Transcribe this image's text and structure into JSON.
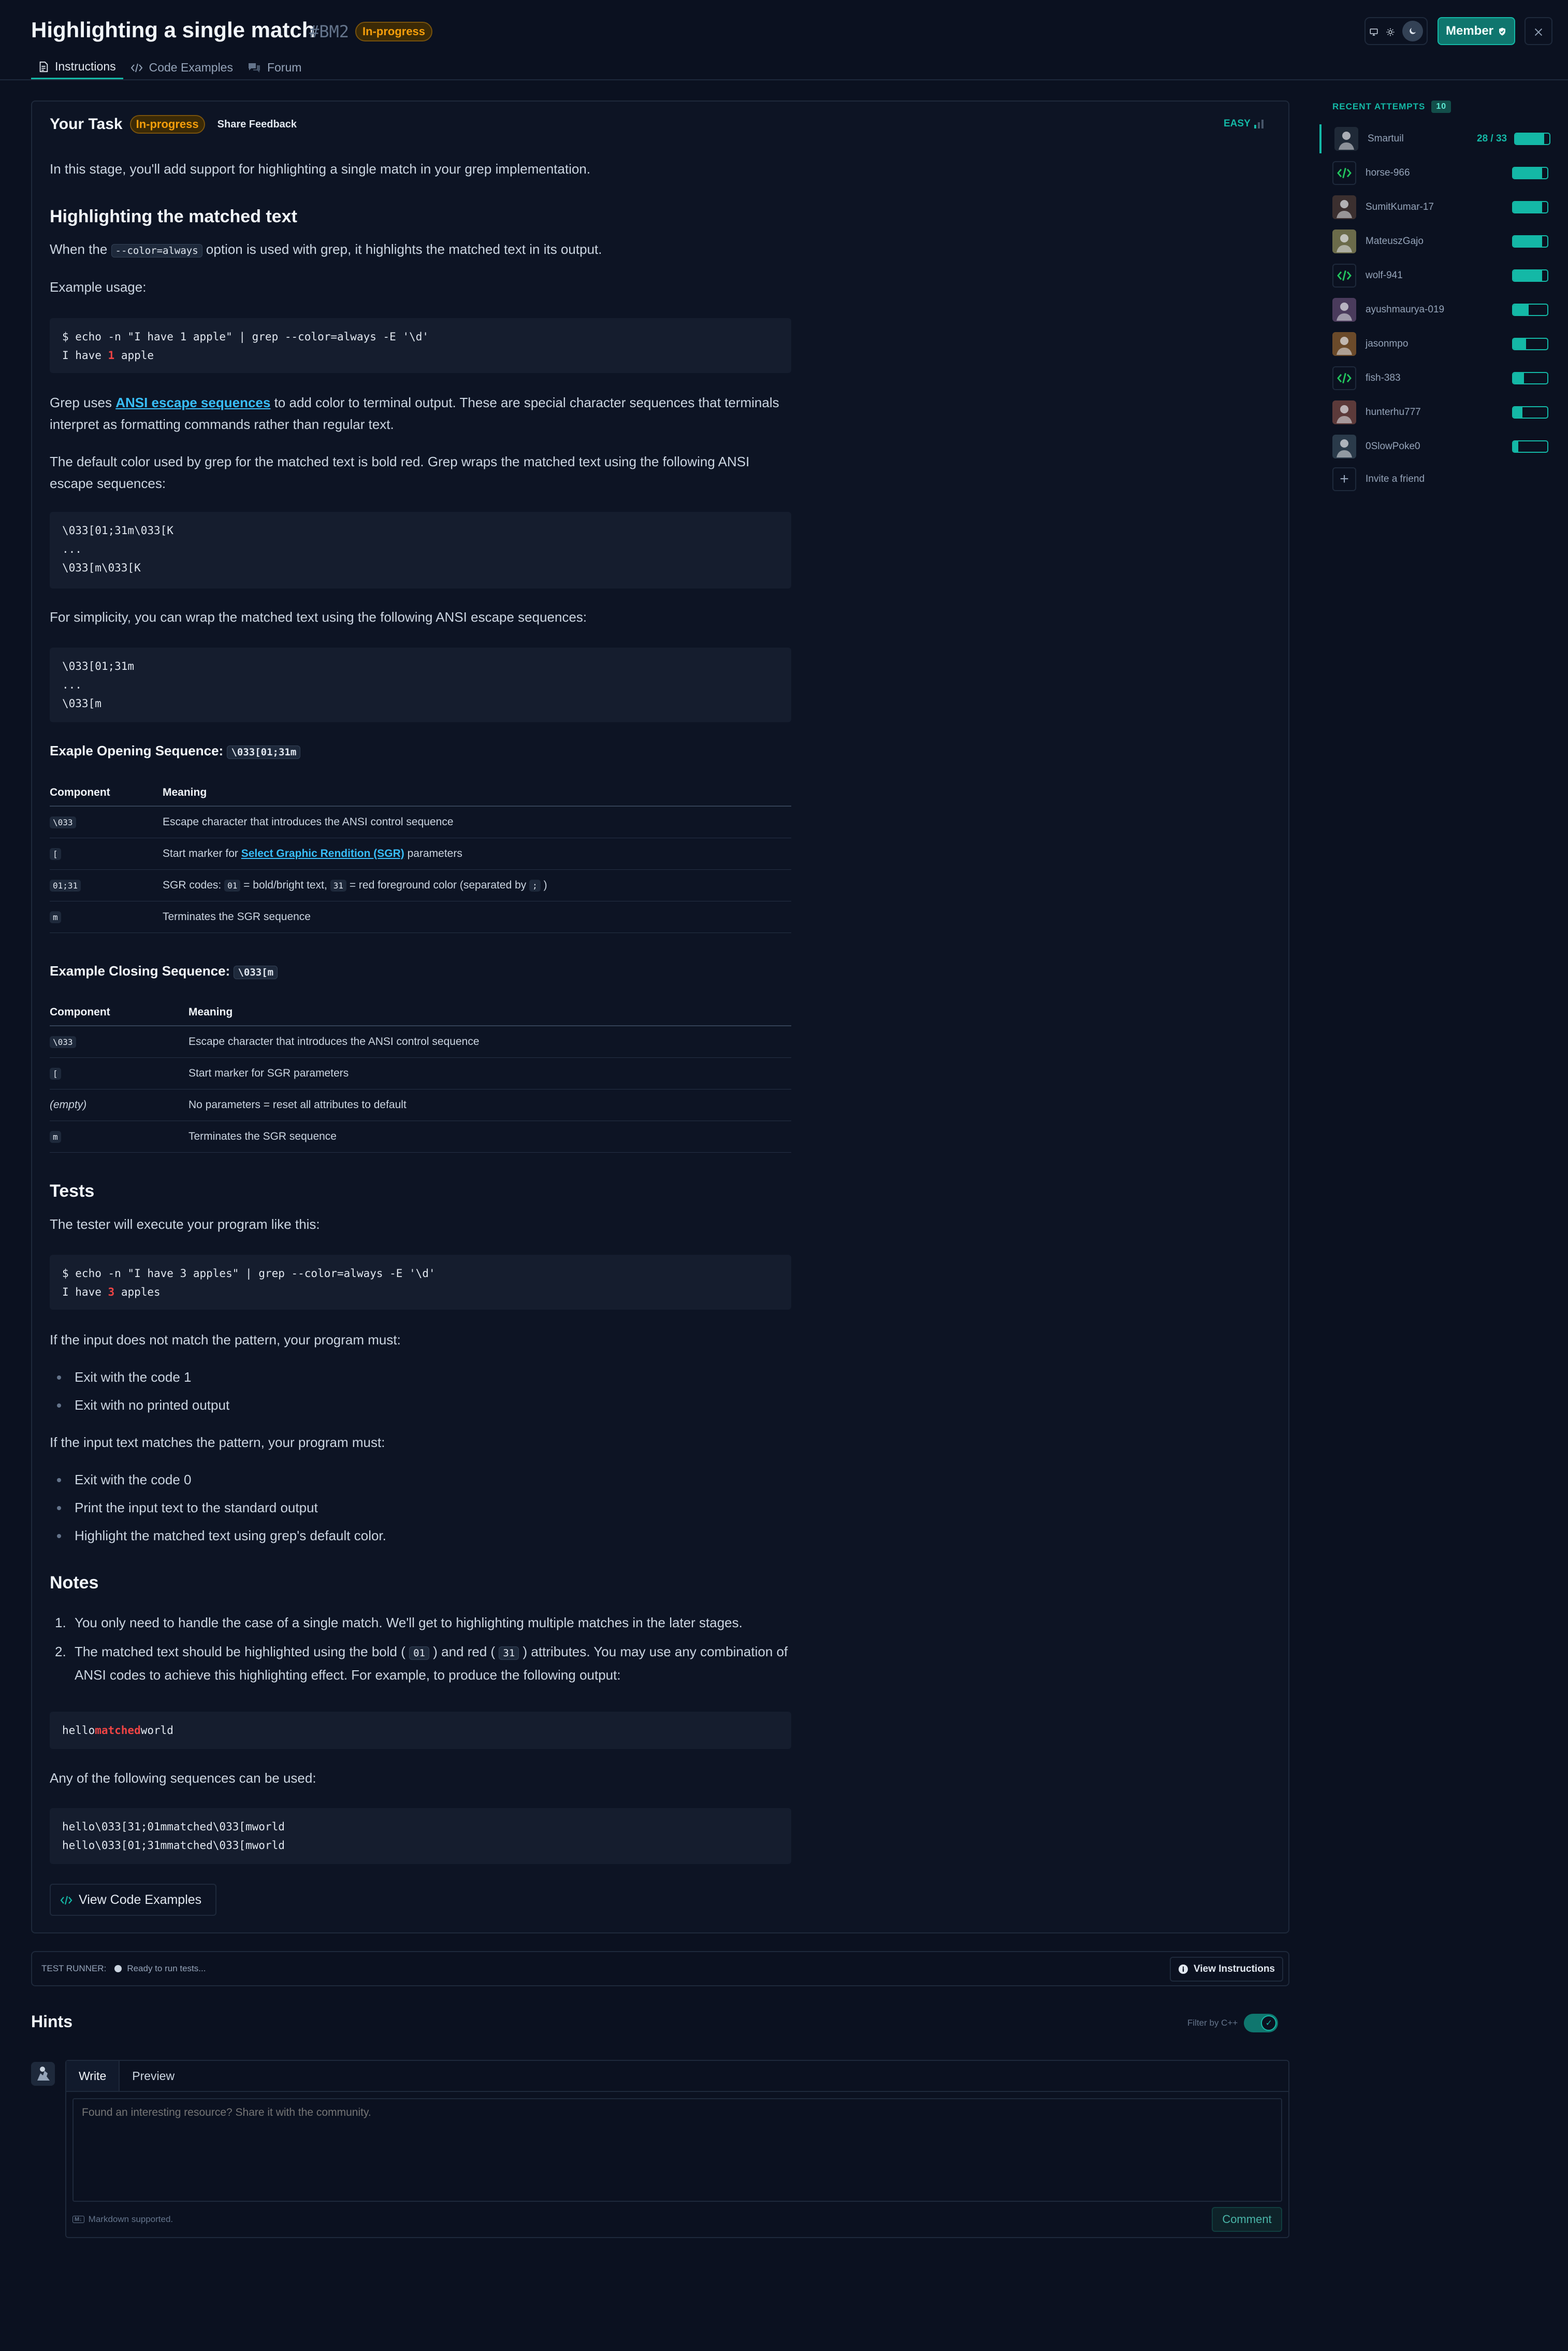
{
  "header": {
    "title": "Highlighting a single match",
    "stage_id": "#BM2",
    "status": "In-progress",
    "member_label": "Member"
  },
  "tabs": [
    {
      "label": "Instructions",
      "icon": "document-icon"
    },
    {
      "label": "Code Examples",
      "icon": "code-icon"
    },
    {
      "label": "Forum",
      "icon": "chat-icon"
    }
  ],
  "task": {
    "title": "Your Task",
    "status": "In-progress",
    "feedback_label": "Share Feedback",
    "difficulty": "EASY"
  },
  "content": {
    "intro": "In this stage, you'll add support for highlighting a single match in your grep implementation.",
    "h_matched": "Highlighting the matched text",
    "when_pre": "When the",
    "when_code": "--color=always",
    "when_post": "option is used with grep, it highlights the matched text in its output.",
    "example_usage": "Example usage:",
    "code1_line1": "$ echo -n \"I have 1 apple\" | grep --color=always -E '\\d'",
    "code1_l2_pre": "I have ",
    "code1_l2_hl": "1",
    "code1_l2_post": " apple",
    "grep_uses_pre": "Grep uses",
    "grep_uses_link": "ANSI escape sequences",
    "grep_uses_post": "to add color to terminal output. These are special character sequences that terminals interpret as formatting commands rather than regular text.",
    "default_color": "The default color used by grep for the matched text is bold red. Grep wraps the matched text using the following ANSI escape sequences:",
    "code2": "\\033[01;31m\\033[K\n...\n\\033[m\\033[K",
    "simplicity": "For simplicity, you can wrap the matched text using the following ANSI escape sequences:",
    "code3": "\\033[01;31m\n...\n\\033[m",
    "opening_label": "Exaple Opening Sequence:",
    "opening_code": "\\033[01;31m",
    "col_component": "Component",
    "col_meaning": "Meaning",
    "row1_comp": "\\033",
    "row1_meaning": "Escape character that introduces the ANSI control sequence",
    "row2_comp": "[",
    "row2_pre": "Start marker for",
    "row2_link": "Select Graphic Rendition (SGR)",
    "row2_post": "parameters",
    "row3_comp": "01;31",
    "row3_pre": "SGR codes:",
    "row3_c1": "01",
    "row3_mid": "= bold/bright text,",
    "row3_c2": "31",
    "row3_mid2": "= red foreground color (separated by",
    "row3_c3": ";",
    "row3_end": ")",
    "row4_comp": "m",
    "row4_meaning": "Terminates the SGR sequence",
    "closing_label": "Example Closing Sequence:",
    "closing_code": "\\033[m",
    "c_row1_comp": "\\033",
    "c_row1_meaning": "Escape character that introduces the ANSI control sequence",
    "c_row2_comp": "[",
    "c_row2_meaning": "Start marker for SGR parameters",
    "c_row3_comp": "(empty)",
    "c_row3_meaning": "No parameters = reset all attributes to default",
    "c_row4_comp": "m",
    "c_row4_meaning": "Terminates the SGR sequence",
    "h_tests": "Tests",
    "tester": "The tester will execute your program like this:",
    "code4_line1": "$ echo -n \"I have 3 apples\" | grep --color=always -E '\\d'",
    "code4_l2_pre": "I have ",
    "code4_l2_hl": "3",
    "code4_l2_post": " apples",
    "no_match": "If the input does not match the pattern, your program must:",
    "no_match_items": [
      "Exit with the code 1",
      "Exit with no printed output"
    ],
    "match": "If the input text matches the pattern, your program must:",
    "match_items": [
      "Exit with the code 0",
      "Print the input text to the standard output",
      "Highlight the matched text using grep's default color."
    ],
    "h_notes": "Notes",
    "note1": "You only need to handle the case of a single match. We'll get to highlighting multiple matches in the later stages.",
    "note2_pre": "The matched text should be highlighted using the bold (",
    "note2_c1": "01",
    "note2_mid": ") and red (",
    "note2_c2": "31",
    "note2_post": ") attributes. You may use any combination of ANSI codes to achieve this highlighting effect. For example, to produce the following output:",
    "code5_pre": "hello",
    "code5_hl": "matched",
    "code5_post": "world",
    "any_following": "Any of the following sequences can be used:",
    "code6": "hello\\033[31;01mmatched\\033[mworld\nhello\\033[01;31mmatched\\033[mworld",
    "view_code_label": "View Code Examples"
  },
  "runner": {
    "label": "TEST RUNNER:",
    "status": "Ready to run tests...",
    "view_instructions": "View Instructions"
  },
  "hints": {
    "title": "Hints",
    "filter_label": "Filter by C++",
    "filter_on": true,
    "tab_write": "Write",
    "tab_preview": "Preview",
    "placeholder": "Found an interesting resource? Share it with the community.",
    "markdown_note": "Markdown supported.",
    "comment_label": "Comment"
  },
  "recent": {
    "title": "RECENT ATTEMPTS",
    "count": "10",
    "invite_label": "Invite a friend",
    "attempts": [
      {
        "name": "Smartuil",
        "score": "28 / 33",
        "progress": 0.85,
        "avatar": "photo"
      },
      {
        "name": "horse-966",
        "score": "",
        "progress": 0.85,
        "avatar": "code-icon"
      },
      {
        "name": "SumitKumar-17",
        "score": "",
        "progress": 0.85,
        "avatar": "photo"
      },
      {
        "name": "MateuszGajo",
        "score": "",
        "progress": 0.85,
        "avatar": "photo"
      },
      {
        "name": "wolf-941",
        "score": "",
        "progress": 0.85,
        "avatar": "code-icon"
      },
      {
        "name": "ayushmaurya-019",
        "score": "",
        "progress": 0.45,
        "avatar": "photo"
      },
      {
        "name": "jasonmpo",
        "score": "",
        "progress": 0.38,
        "avatar": "photo"
      },
      {
        "name": "fish-383",
        "score": "",
        "progress": 0.32,
        "avatar": "code-icon"
      },
      {
        "name": "hunterhu777",
        "score": "",
        "progress": 0.28,
        "avatar": "photo"
      },
      {
        "name": "0SlowPoke0",
        "score": "",
        "progress": 0.15,
        "avatar": "photo"
      }
    ]
  }
}
